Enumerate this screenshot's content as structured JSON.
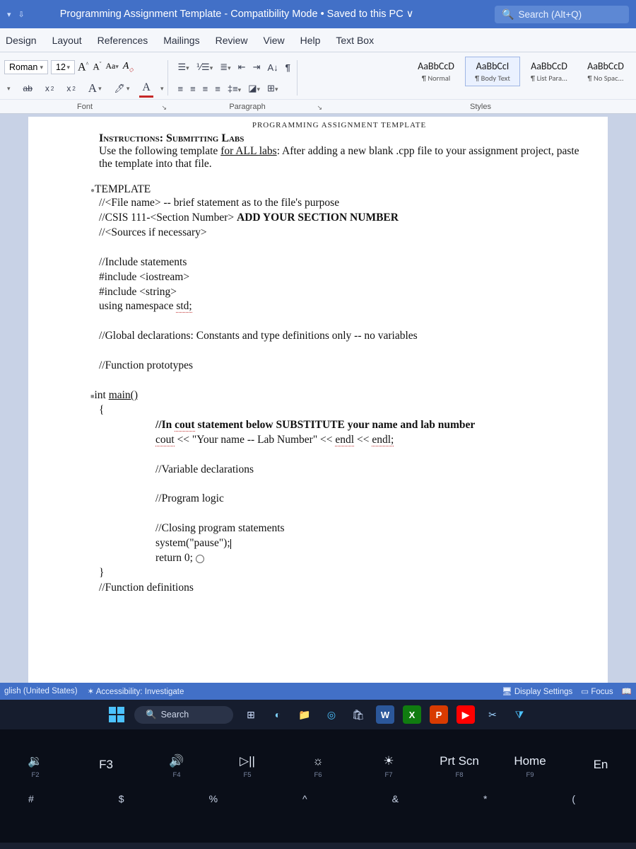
{
  "titlebar": {
    "doc_title": "Programming Assignment Template - Compatibility Mode • Saved to this PC ∨",
    "search_placeholder": "Search (Alt+Q)"
  },
  "tabs": {
    "design": "Design",
    "layout": "Layout",
    "references": "References",
    "mailings": "Mailings",
    "review": "Review",
    "view": "View",
    "help": "Help",
    "textbox": "Text Box"
  },
  "font": {
    "name_partial": "Roman",
    "size": "12"
  },
  "styles": {
    "s1": {
      "preview": "AaBbCcD",
      "name": "¶ Normal"
    },
    "s2": {
      "preview": "AaBbCcI",
      "name": "¶ Body Text"
    },
    "s3": {
      "preview": "AaBbCcD",
      "name": "¶ List Para..."
    },
    "s4": {
      "preview": "AaBbCcD",
      "name": "¶ No Spac..."
    }
  },
  "groups": {
    "font": "Font",
    "paragraph": "Paragraph",
    "styles": "Styles"
  },
  "doc": {
    "banner_sub": "PROGRAMMING ASSIGNMENT TEMPLATE",
    "instr_head": "Instructions: Submitting Labs",
    "instr_body1": "Use the following template ",
    "instr_body_underline": "for ALL labs",
    "instr_body2": ":  After adding a new blank .cpp file to your assignment project, paste the template into that file.",
    "template_head": "TEMPLATE",
    "l1": "//<File name> -- brief statement as to the file's purpose",
    "l2a": "//CSIS 111-<Section Number> ",
    "l2b": "ADD YOUR SECTION NUMBER",
    "l3": "//<Sources if necessary>",
    "l4": "//Include statements",
    "l5": "#include <iostream>",
    "l6": "#include <string>",
    "l7a": "using namespace ",
    "l7b": "std;",
    "l8": "//Global declarations: Constants and type definitions only -- no variables",
    "l9": "//Function prototypes",
    "l10a": "int ",
    "l10b": "main()",
    "l11": "{",
    "l12a": "//In ",
    "l12b": "cout",
    "l12c": " statement below SUBSTITUTE  your name and lab number",
    "l13a": "cout",
    "l13b": " << \"Your name -- Lab Number\" << ",
    "l13c": "endl",
    "l13d": " << ",
    "l13e": "endl;",
    "l14": "//Variable declarations",
    "l15": "//Program logic",
    "l16": "//Closing program statements",
    "l17a": "system(\"pause\")",
    "l17b": ";",
    "l18": "return 0;",
    "l19": "}",
    "l20": "//Function definitions"
  },
  "status": {
    "lang": "glish (United States)",
    "access": "Accessibility: Investigate",
    "display": "Display Settings",
    "focus": "Focus"
  },
  "taskbar": {
    "search": "Search"
  },
  "keys": {
    "f2": "F2",
    "f3": "F3",
    "f4": "F4",
    "f5": "F5",
    "f6": "F6",
    "f7": "F7",
    "f8": "F8",
    "f9": "F9",
    "prtscn": "Prt Scn",
    "home": "Home",
    "end": "En",
    "hash": "#",
    "dollar": "$",
    "percent": "%",
    "caret_top": "^",
    "amp": "&",
    "star": "*",
    "lparen": "("
  }
}
